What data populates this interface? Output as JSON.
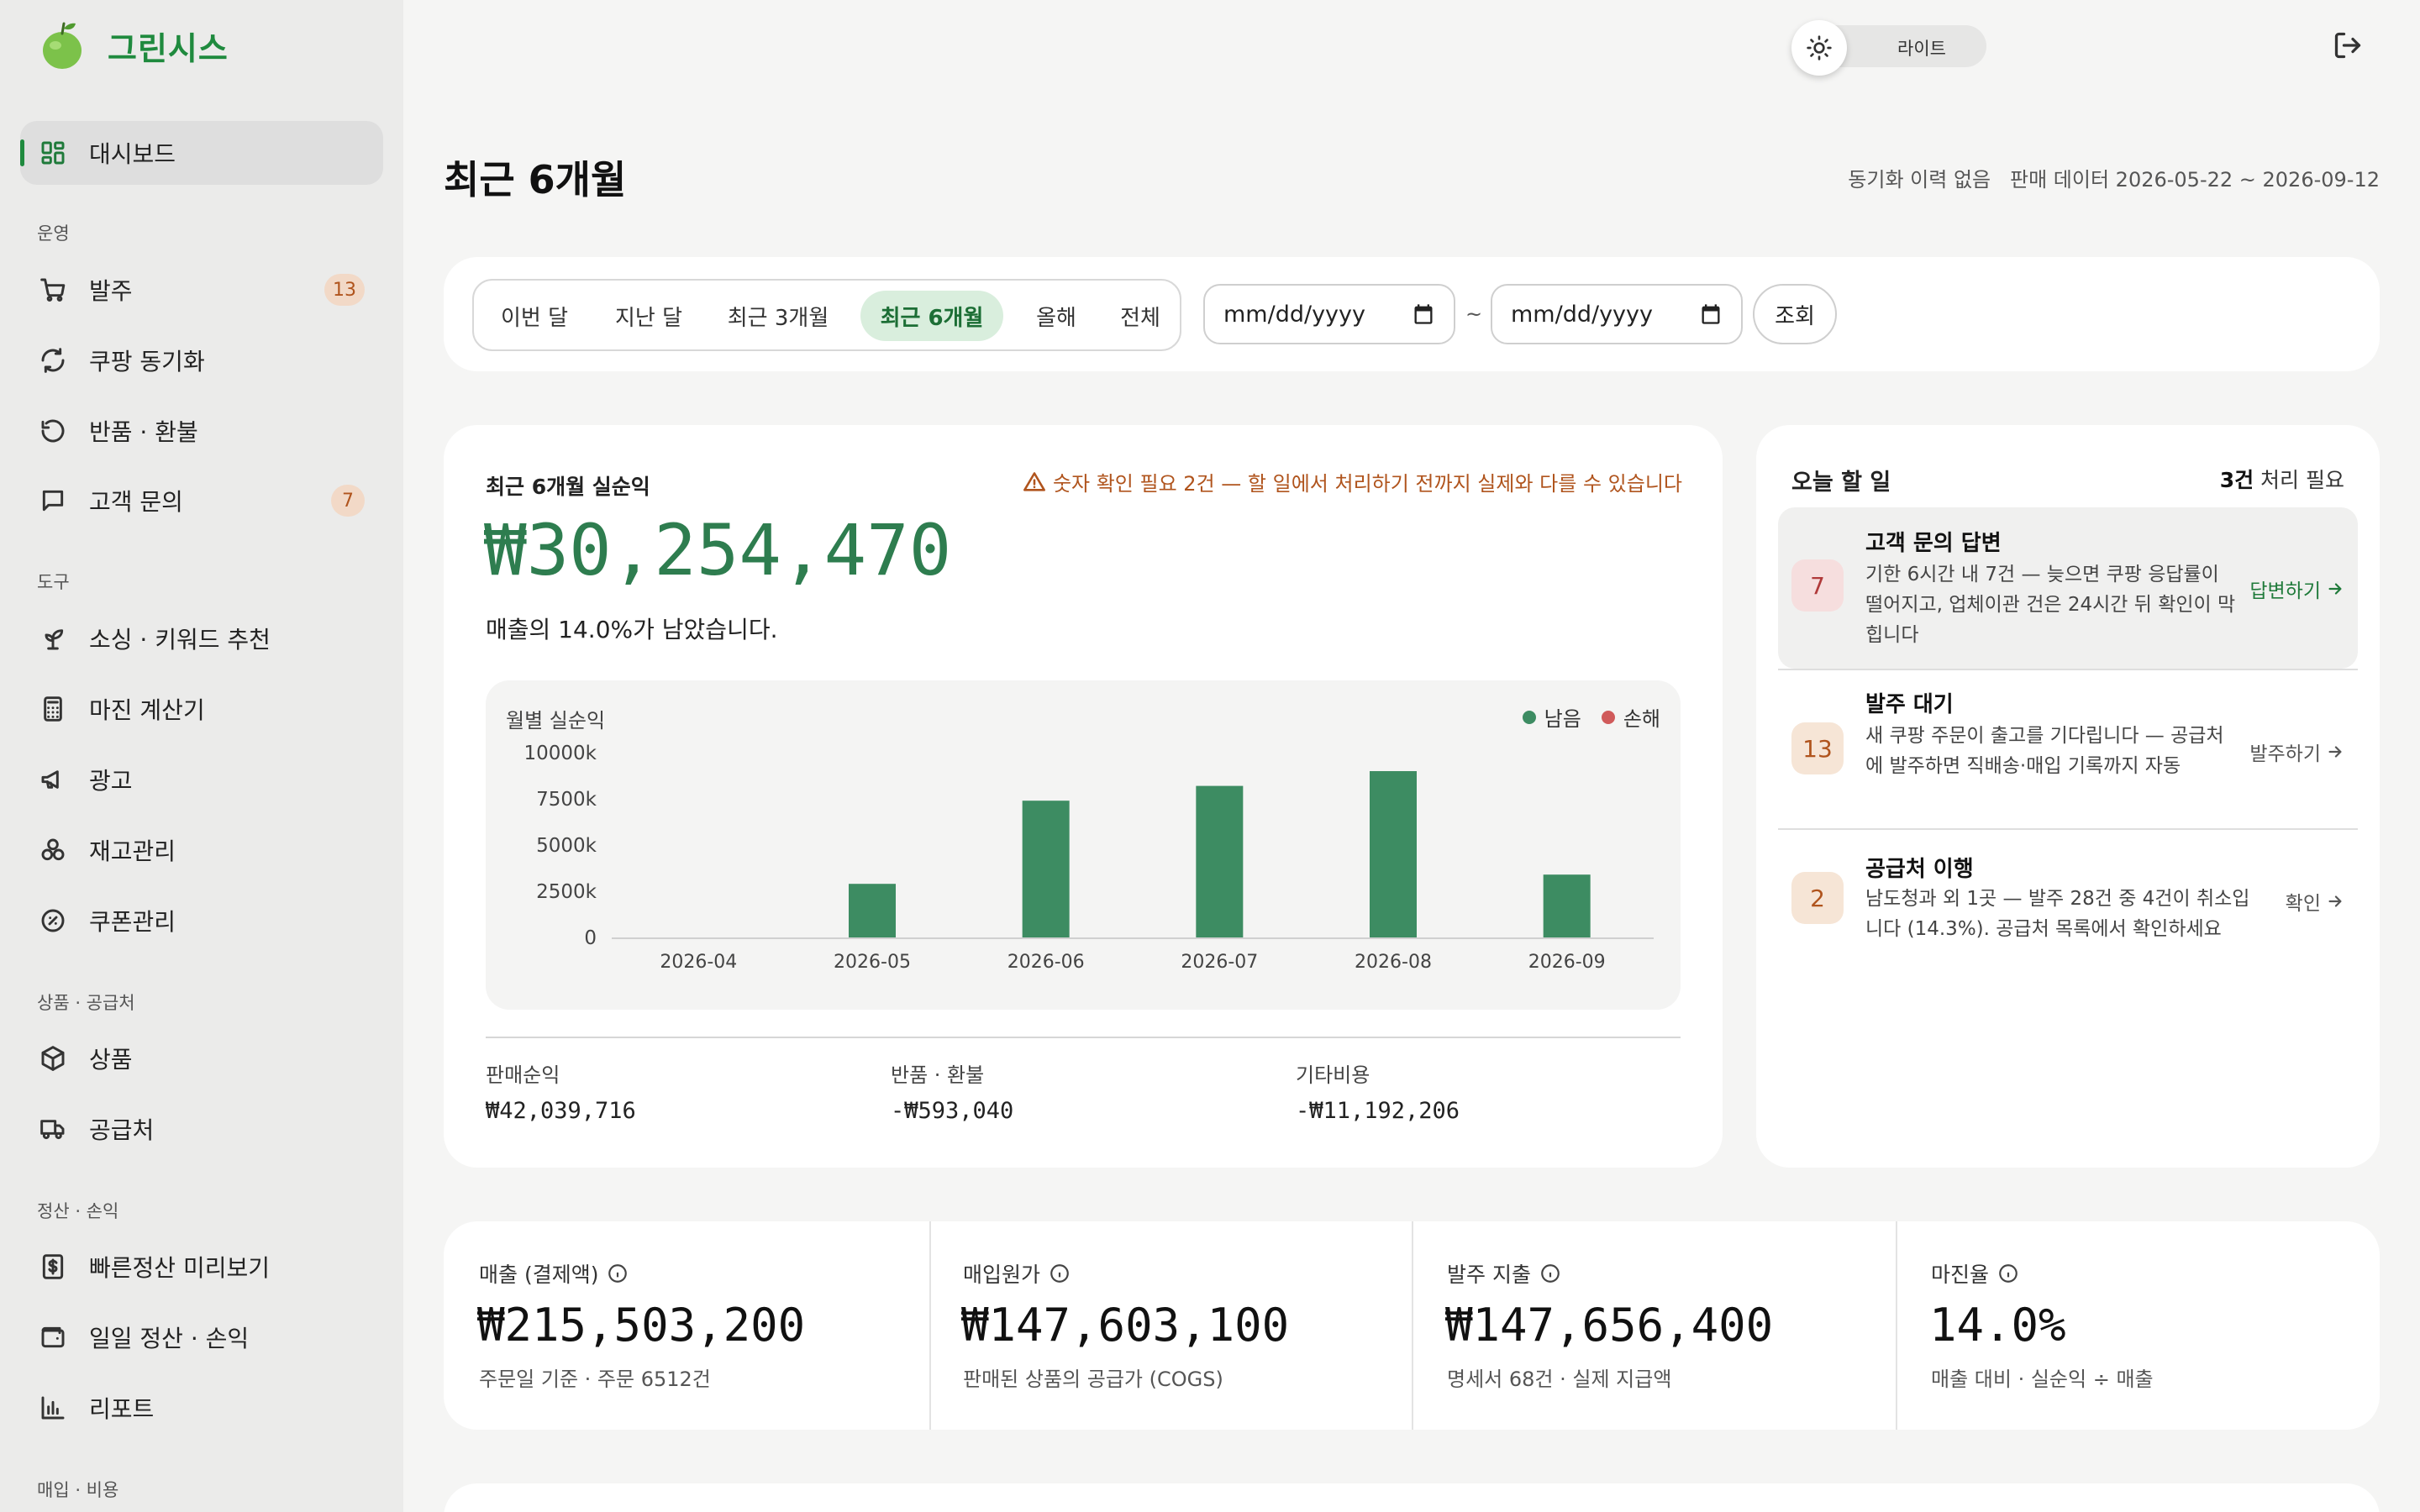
{
  "brand": {
    "name": "그린시스"
  },
  "sidebar": {
    "dashboard": "대시보드",
    "sections": {
      "ops": "운영",
      "tools": "도구",
      "products": "상품 · 공급처",
      "settlement": "정산 · 손익",
      "purchase": "매입 · 비용"
    },
    "items": {
      "orders": {
        "label": "발주",
        "badge": "13",
        "icon": "cart-icon"
      },
      "coupang_sync": {
        "label": "쿠팡 동기화",
        "icon": "sync-icon"
      },
      "returns": {
        "label": "반품 · 환불",
        "icon": "undo-icon"
      },
      "inquiries": {
        "label": "고객 문의",
        "badge": "7",
        "icon": "chat-icon"
      },
      "sourcing": {
        "label": "소싱 · 키워드 추천",
        "icon": "sprout-icon"
      },
      "margin_calc": {
        "label": "마진 계산기",
        "icon": "calculator-icon"
      },
      "ads": {
        "label": "광고",
        "icon": "megaphone-icon"
      },
      "inventory": {
        "label": "재고관리",
        "icon": "boxes-icon"
      },
      "coupons": {
        "label": "쿠폰관리",
        "icon": "coupon-icon"
      },
      "products": {
        "label": "상품",
        "icon": "package-icon"
      },
      "suppliers": {
        "label": "공급처",
        "icon": "truck-icon"
      },
      "quick_settle": {
        "label": "빠른정산 미리보기",
        "icon": "dollar-doc-icon"
      },
      "daily_settle": {
        "label": "일일 정산 · 손익",
        "icon": "wallet-icon"
      },
      "reports": {
        "label": "리포트",
        "icon": "bar-chart-icon"
      }
    }
  },
  "topbar": {
    "theme_label": "라이트"
  },
  "page": {
    "title": "최근 6개월",
    "sync_status": "동기화 이력 없음",
    "sales_range": "판매 데이터 2026-05-22 ~ 2026-09-12"
  },
  "filter": {
    "periods": [
      "이번 달",
      "지난 달",
      "최근 3개월",
      "최근 6개월",
      "올해",
      "전체"
    ],
    "active_period": "최근 6개월",
    "date_placeholder": "mm/dd/yyyy",
    "tilde": "~",
    "search_label": "조회"
  },
  "profit": {
    "label": "최근 6개월 실순익",
    "warning": "숫자 확인 필요 2건 — 할 일에서 처리하기 전까지 실제와 다를 수 있습니다",
    "value": "₩30,254,470",
    "subtitle": "매출의 14.0%가 남았습니다.",
    "chart_title": "월별 실순익",
    "legend_profit": "남음",
    "legend_loss": "손해",
    "sub_stats": [
      {
        "label": "판매순익",
        "value": "₩42,039,716"
      },
      {
        "label": "반품 · 환불",
        "value": "-₩593,040"
      },
      {
        "label": "기타비용",
        "value": "-₩11,192,206"
      }
    ]
  },
  "chart_data": {
    "type": "bar",
    "title": "월별 실순익",
    "categories": [
      "2026-04",
      "2026-05",
      "2026-06",
      "2026-07",
      "2026-08",
      "2026-09"
    ],
    "series": [
      {
        "name": "남음",
        "values": [
          0,
          2900000,
          7400000,
          8200000,
          9000000,
          3400000
        ],
        "color": "#3d8c62"
      },
      {
        "name": "손해",
        "values": [
          0,
          0,
          0,
          0,
          0,
          0
        ],
        "color": "#d05a5a"
      }
    ],
    "yticks": [
      "0",
      "2500k",
      "5000k",
      "7500k",
      "10000k"
    ],
    "ylim": [
      0,
      10000000
    ],
    "grid": false,
    "legend": "top-right"
  },
  "todo": {
    "title": "오늘 할 일",
    "count_num": "3건",
    "count_suffix": " 처리 필요",
    "items": [
      {
        "num": "7",
        "title": "고객 문의 답변",
        "desc": "기한 6시간 내 7건 — 늦으면 쿠팡 응답률이 떨어지고, 업체이관 건은 24시간 뒤 확인이 막힙니다",
        "action": "답변하기"
      },
      {
        "num": "13",
        "title": "발주 대기",
        "desc": "새 쿠팡 주문이 출고를 기다립니다 — 공급처에 발주하면 직배송·매입 기록까지 자동",
        "action": "발주하기"
      },
      {
        "num": "2",
        "title": "공급처 이행",
        "desc": "남도청과 외 1곳 — 발주 28건 중 4건이 취소입니다 (14.3%). 공급처 목록에서 확인하세요",
        "action": "확인"
      }
    ]
  },
  "kpis": [
    {
      "label": "매출 (결제액)",
      "value": "₩215,503,200",
      "note": "주문일 기준 · 주문 6512건"
    },
    {
      "label": "매입원가",
      "value": "₩147,603,100",
      "note": "판매된 상품의 공급가 (COGS)"
    },
    {
      "label": "발주 지출",
      "value": "₩147,656,400",
      "note": "명세서 68건 · 실제 지급액"
    },
    {
      "label": "마진율",
      "value": "14.0%",
      "note": "매출 대비 · 실순익 ÷ 매출"
    }
  ]
}
